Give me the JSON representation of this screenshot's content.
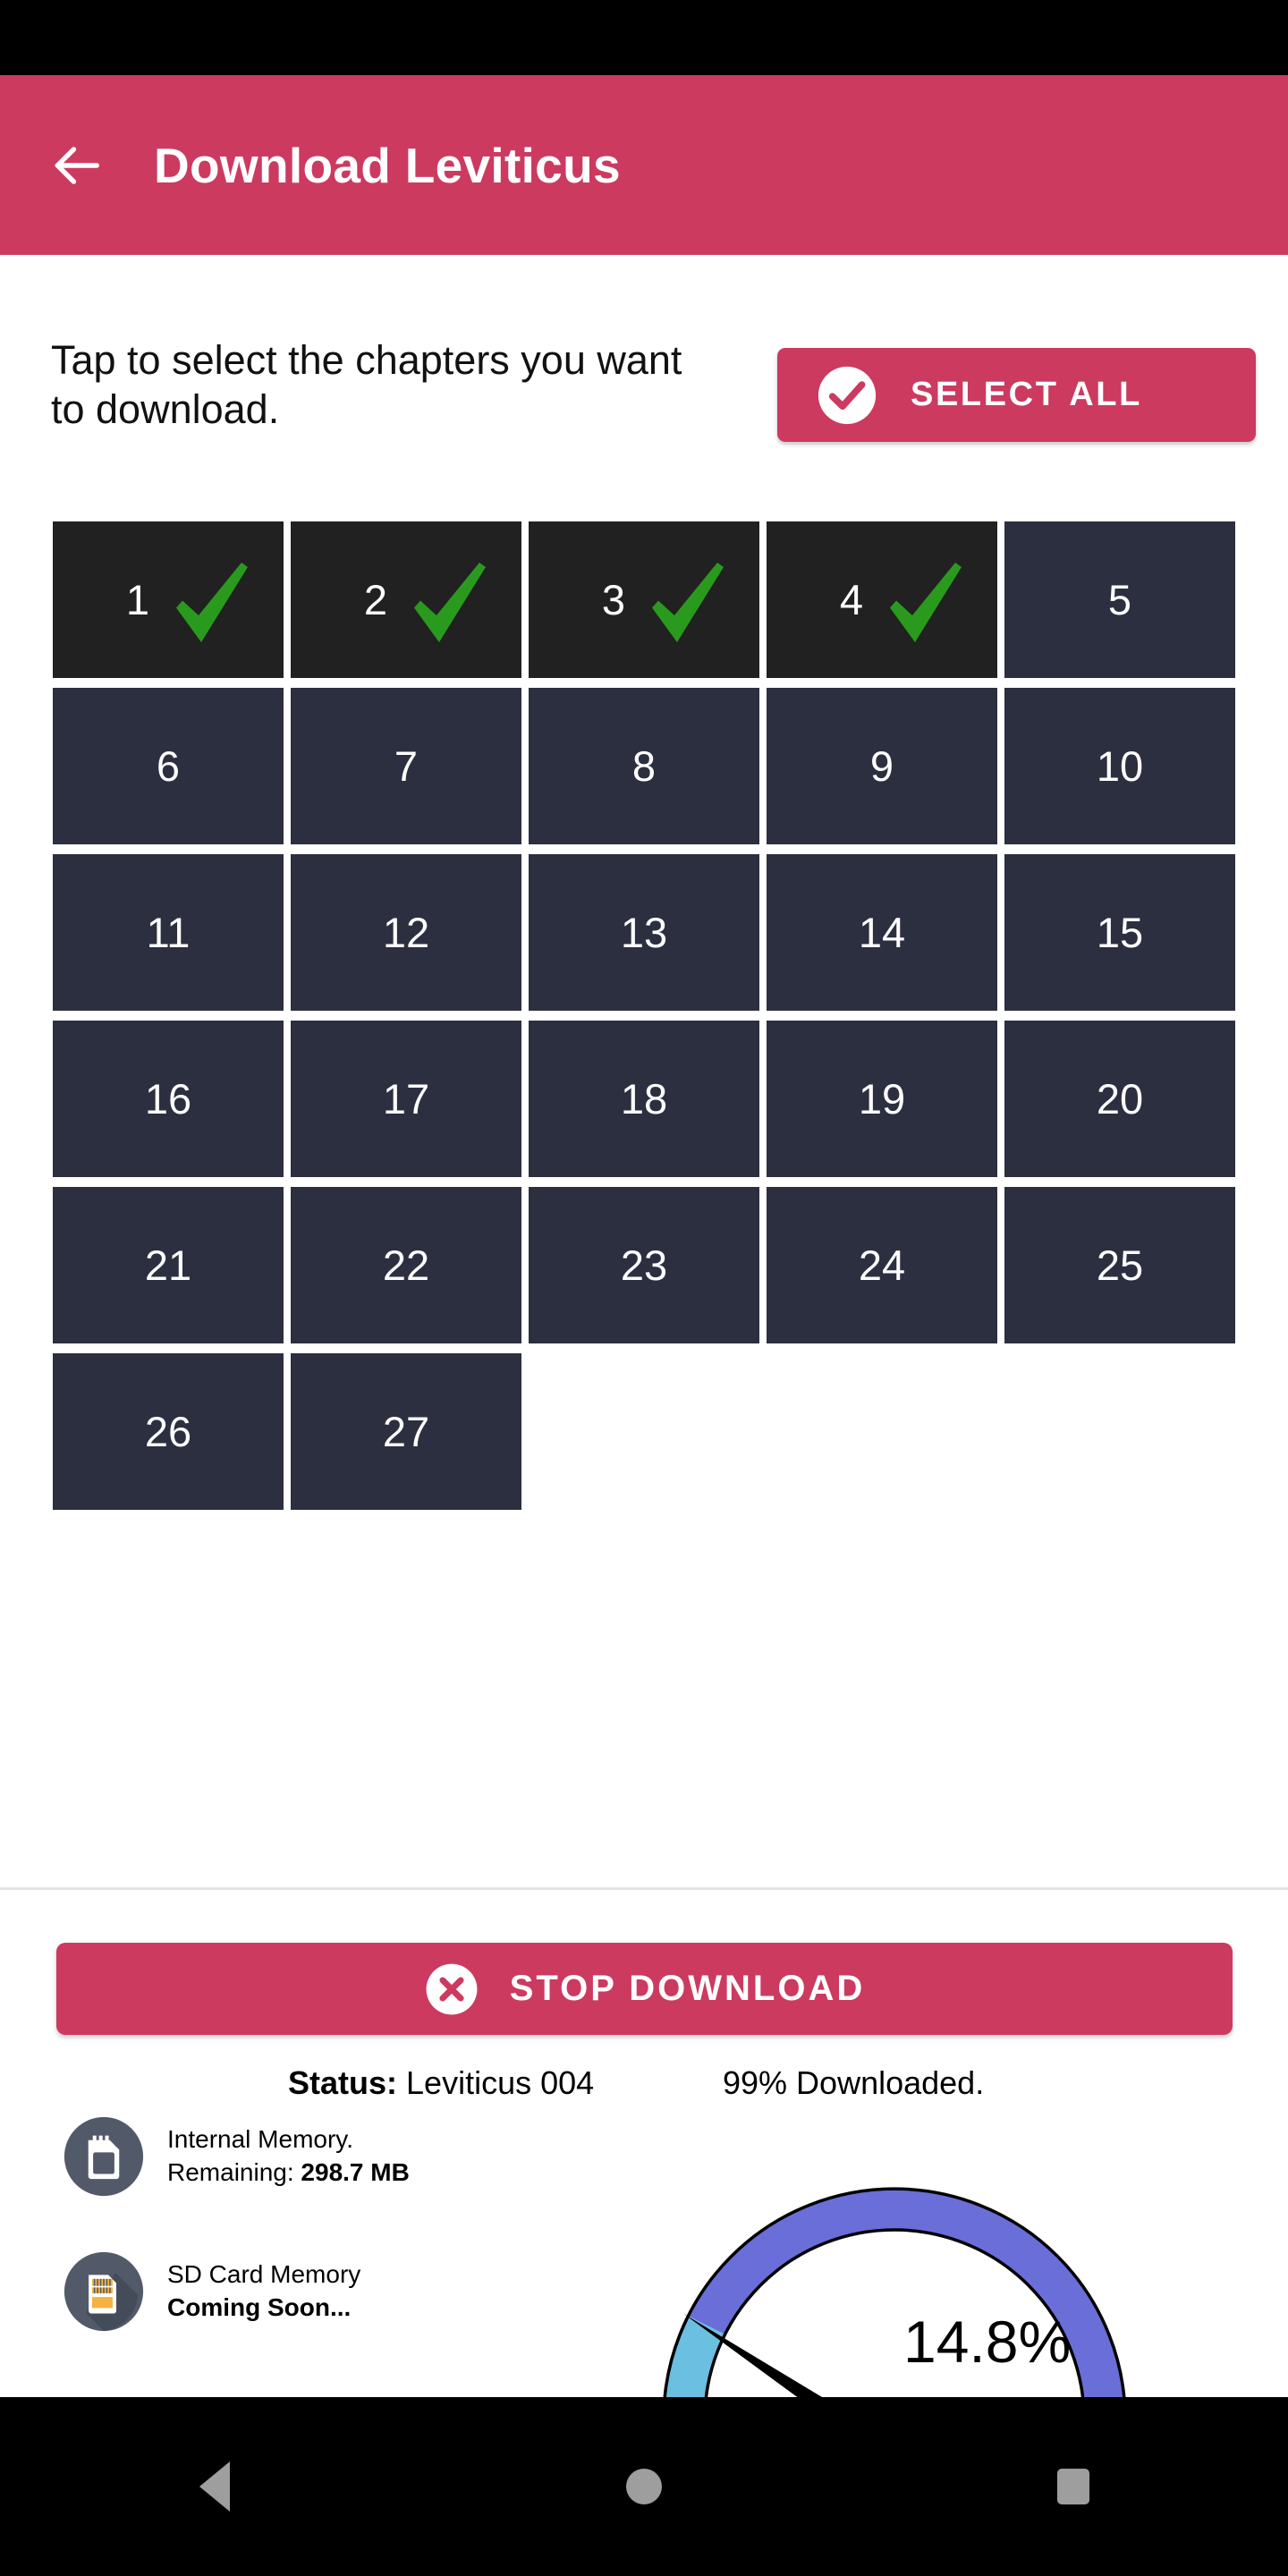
{
  "app_bar": {
    "back_icon": "arrow-left-icon",
    "title": "Download Leviticus",
    "background_color": "#cc3a60"
  },
  "instructions": {
    "text": "Tap to select the chapters you want to download."
  },
  "select_all": {
    "label": "SELECT ALL",
    "icon": "check-circle-icon",
    "color": "#cc3a60"
  },
  "chapters": {
    "total": 27,
    "selected": [
      1,
      2,
      3,
      4
    ],
    "check_color": "#2a9a1e",
    "selected_bg": "#212121",
    "unselected_bg": "#2c2f40",
    "items": [
      {
        "n": "1",
        "selected": true
      },
      {
        "n": "2",
        "selected": true
      },
      {
        "n": "3",
        "selected": true
      },
      {
        "n": "4",
        "selected": true
      },
      {
        "n": "5",
        "selected": false
      },
      {
        "n": "6",
        "selected": false
      },
      {
        "n": "7",
        "selected": false
      },
      {
        "n": "8",
        "selected": false
      },
      {
        "n": "9",
        "selected": false
      },
      {
        "n": "10",
        "selected": false
      },
      {
        "n": "11",
        "selected": false
      },
      {
        "n": "12",
        "selected": false
      },
      {
        "n": "13",
        "selected": false
      },
      {
        "n": "14",
        "selected": false
      },
      {
        "n": "15",
        "selected": false
      },
      {
        "n": "16",
        "selected": false
      },
      {
        "n": "17",
        "selected": false
      },
      {
        "n": "18",
        "selected": false
      },
      {
        "n": "19",
        "selected": false
      },
      {
        "n": "20",
        "selected": false
      },
      {
        "n": "21",
        "selected": false
      },
      {
        "n": "22",
        "selected": false
      },
      {
        "n": "23",
        "selected": false
      },
      {
        "n": "24",
        "selected": false
      },
      {
        "n": "25",
        "selected": false
      },
      {
        "n": "26",
        "selected": false
      },
      {
        "n": "27",
        "selected": false
      }
    ]
  },
  "stop_download": {
    "label": "STOP DOWNLOAD",
    "icon": "x-circle-icon",
    "color": "#cc3a60"
  },
  "status": {
    "label": "Status:",
    "value": "Leviticus 004",
    "progress_text": "99% Downloaded."
  },
  "memory": {
    "internal": {
      "icon": "memory-card-icon",
      "line1": "Internal Memory.",
      "line2_label": "Remaining:",
      "line2_value": "298.7 MB"
    },
    "sd": {
      "icon": "sd-card-icon",
      "line1": "SD Card Memory",
      "line2": "Coming Soon..."
    }
  },
  "gauge": {
    "value_text": "14.8%",
    "value": 14.8,
    "min": 0,
    "max": 100,
    "progress_color": "#6bbfe0",
    "track_color": "#6a6ed8",
    "needle_color": "#000000"
  },
  "nav_bar": {
    "back": "nav-back-icon",
    "home": "nav-home-icon",
    "recents": "nav-recents-icon"
  }
}
